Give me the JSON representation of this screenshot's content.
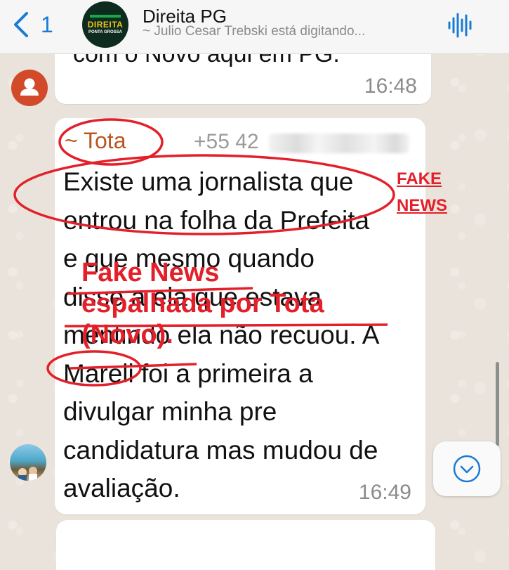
{
  "header": {
    "back_count": "1",
    "chat_title": "Direita PG",
    "chat_subtitle": "~ Julio Cesar Trebski está digitando...",
    "avatar_text_main": "DIREITA",
    "avatar_text_sub": "PONTA GROSSA",
    "audio_icon": "audio-waveform-icon",
    "back_icon": "chevron-left-icon"
  },
  "previous_message": {
    "text": "com o Novo aqui em PG.",
    "time": "16:48"
  },
  "message": {
    "sender": "~ Tota",
    "phone": "+55 42",
    "lines": [
      "Existe uma jornalista que",
      "entrou na folha da Prefeita",
      "e que mesmo quando",
      "disse a ela que estava",
      "mentindo ela não recuou. A",
      "Mareli foi a primeira a",
      "divulgar minha pre",
      "candidatura mas mudou de",
      "avaliação."
    ],
    "time": "16:49"
  },
  "annotations": {
    "tag_line1": "FAKE",
    "tag_line2": "NEWS",
    "big_line1": "Fake News",
    "big_line2": "espalhada por Tota",
    "big_line3": "(Novo).",
    "color": "#e3202a"
  },
  "controls": {
    "scroll_down_icon": "chevron-down-circle-icon"
  }
}
